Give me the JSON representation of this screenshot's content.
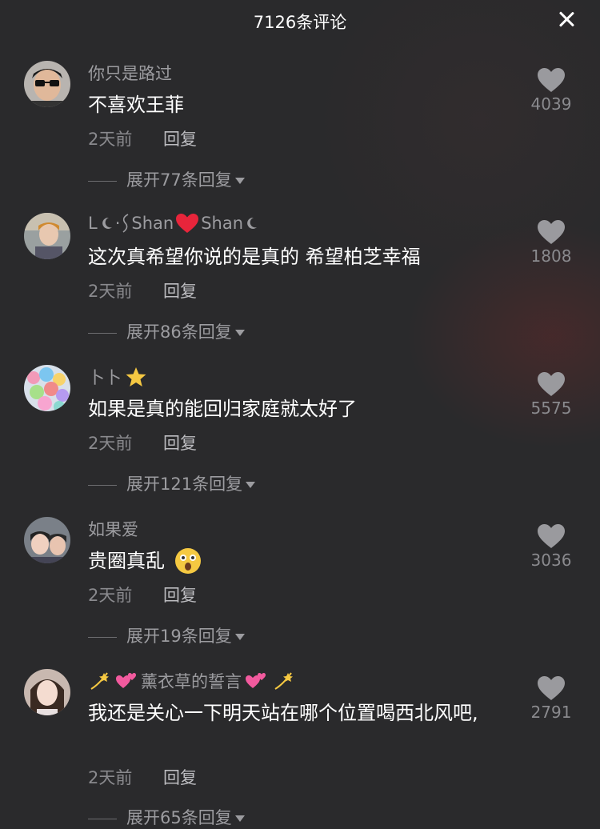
{
  "header": {
    "title": "7126条评论",
    "close_icon": "close-icon"
  },
  "colors": {
    "background": "#2a2a2c",
    "name_gray": "#9c9ca0",
    "meta_gray": "#8a8a8e",
    "heart_gray": "#9a9a9e",
    "heart_red": "#e8253b"
  },
  "comments": [
    {
      "name": "你只是路过",
      "text": "不喜欢王菲",
      "time": "2天前",
      "reply": "回复",
      "expand": "展开77条回复",
      "likes": "4039"
    },
    {
      "name_parts": [
        "L",
        "·",
        "Shan",
        "Shan"
      ],
      "text": "这次真希望你说的是真的 希望柏芝幸福",
      "time": "2天前",
      "reply": "回复",
      "expand": "展开86条回复",
      "likes": "1808"
    },
    {
      "name": "卜卜",
      "text": "如果是真的能回归家庭就太好了",
      "time": "2天前",
      "reply": "回复",
      "expand": "展开121条回复",
      "likes": "5575"
    },
    {
      "name": "如果爱",
      "text": "贵圈真乱",
      "time": "2天前",
      "reply": "回复",
      "expand": "展开19条回复",
      "likes": "3036"
    },
    {
      "name": "薰衣草的誓言",
      "text": "我还是关心一下明天站在哪个位置喝西北风吧,",
      "time": "2天前",
      "reply": "回复",
      "expand": "展开65条回复",
      "likes": "2791"
    }
  ]
}
